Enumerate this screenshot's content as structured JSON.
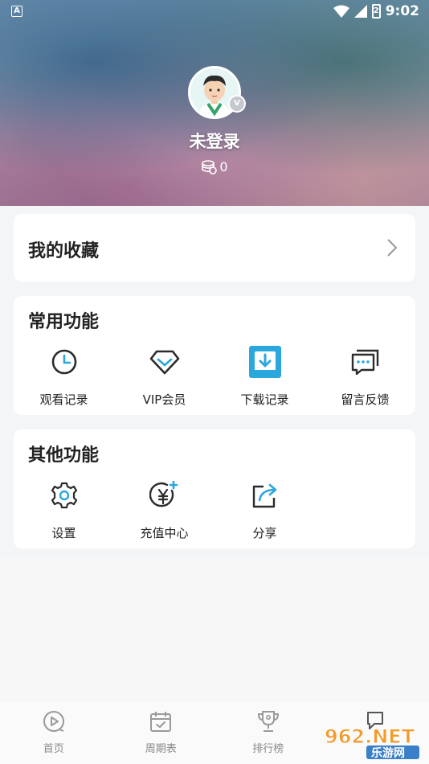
{
  "status_bar": {
    "time": "9:02",
    "notification_icon": "A",
    "battery_level": "2"
  },
  "profile": {
    "username": "未登录",
    "coins": "0",
    "vip_badge": "V"
  },
  "favorites": {
    "label": "我的收藏"
  },
  "common_functions": {
    "title": "常用功能",
    "items": [
      {
        "label": "观看记录",
        "icon": "clock-icon"
      },
      {
        "label": "VIP会员",
        "icon": "diamond-icon"
      },
      {
        "label": "下载记录",
        "icon": "download-icon"
      },
      {
        "label": "留言反馈",
        "icon": "message-icon"
      }
    ]
  },
  "other_functions": {
    "title": "其他功能",
    "items": [
      {
        "label": "设置",
        "icon": "gear-icon"
      },
      {
        "label": "充值中心",
        "icon": "yuan-icon"
      },
      {
        "label": "分享",
        "icon": "share-icon"
      }
    ]
  },
  "bottom_nav": {
    "items": [
      {
        "label": "首页",
        "icon": "play-icon"
      },
      {
        "label": "周期表",
        "icon": "calendar-icon"
      },
      {
        "label": "排行榜",
        "icon": "trophy-icon"
      },
      {
        "label": "",
        "icon": "chat-icon"
      }
    ]
  },
  "watermark": {
    "top": "962.NET",
    "bottom": "乐游网"
  },
  "colors": {
    "accent": "#2aa7de",
    "text_dark": "#222222",
    "nav_gray": "#888888",
    "card_bg": "#ffffff",
    "page_bg": "#f4f5f7"
  }
}
